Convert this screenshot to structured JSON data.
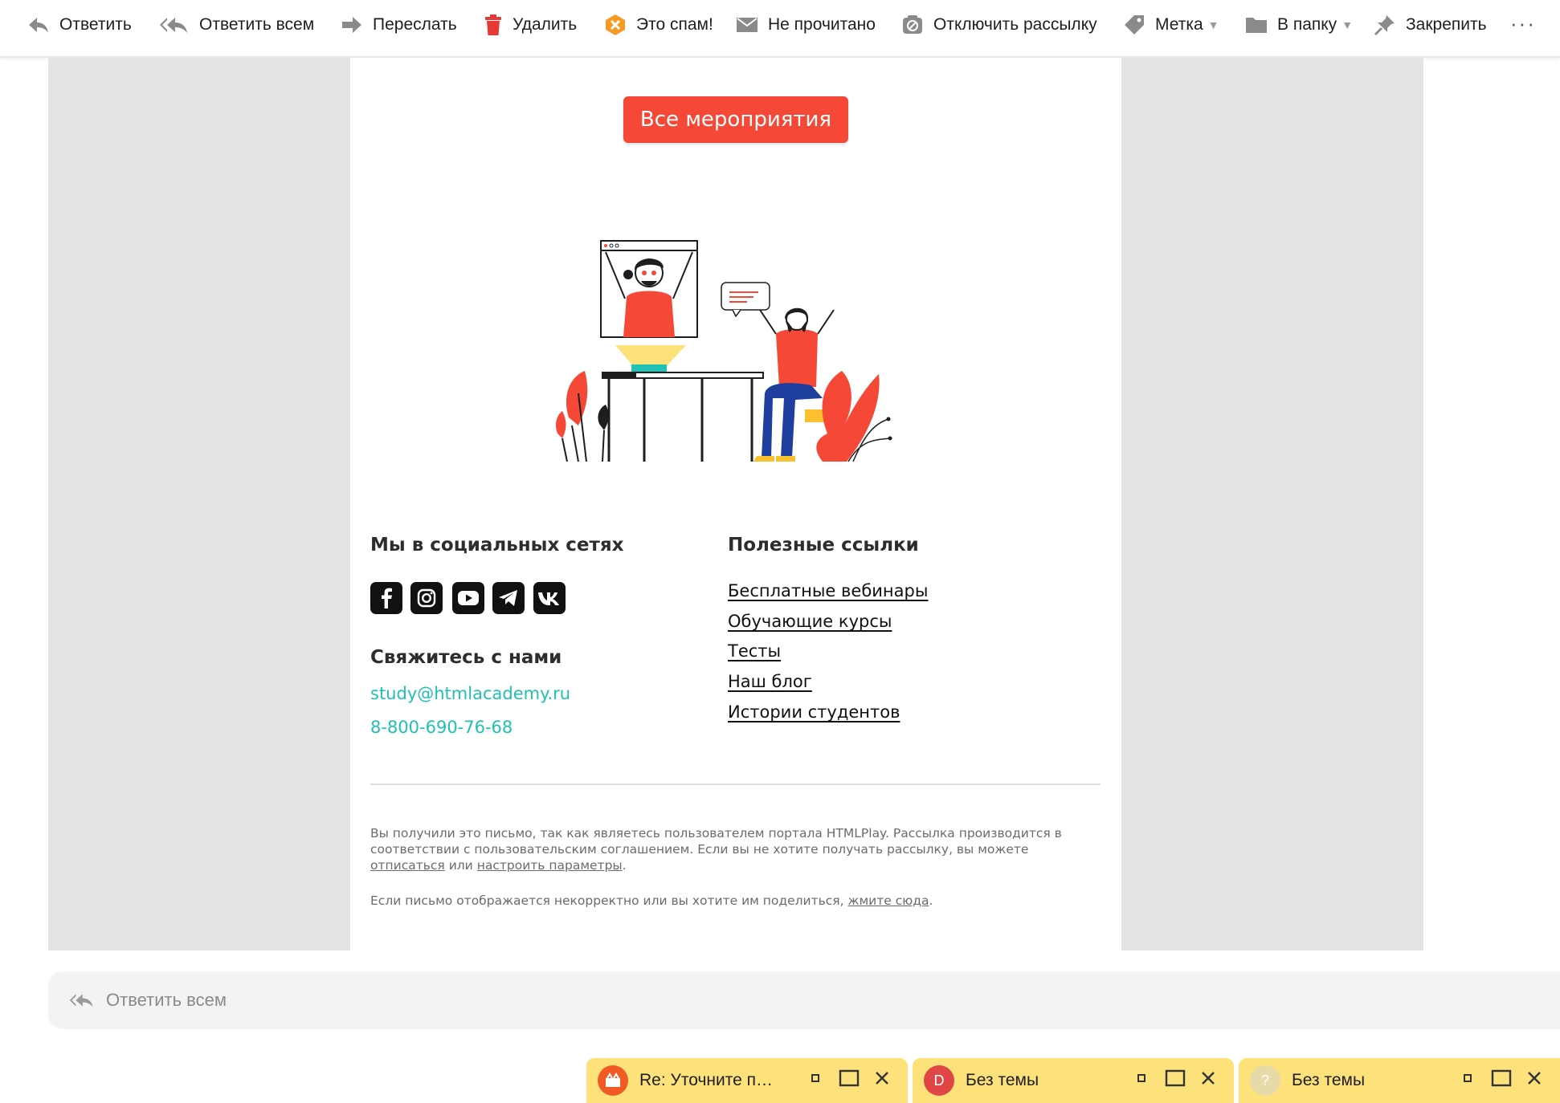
{
  "toolbar": {
    "reply": "Ответить",
    "reply_all": "Ответить всем",
    "forward": "Переслать",
    "delete": "Удалить",
    "spam": "Это спам!",
    "unread": "Не прочитано",
    "unsubscribe": "Отключить рассылку",
    "label": "Метка",
    "folder": "В папку",
    "pin": "Закрепить",
    "more": "···"
  },
  "email": {
    "cta": "Все мероприятия",
    "social_heading": "Мы в социальных сетях",
    "social_icons": [
      "facebook-icon",
      "instagram-icon",
      "youtube-icon",
      "telegram-icon",
      "vk-icon"
    ],
    "contact_heading": "Свяжитесь с нами",
    "email": "study@htmlacademy.ru",
    "phone": "8-800-690-76-68",
    "links_heading": "Полезные ссылки",
    "links": [
      "Бесплатные вебинары",
      "Обучающие курсы",
      "Тесты",
      "Наш блог",
      "Истории студентов"
    ],
    "footer_p1_a": "Вы получили это письмо, так как являетесь пользователем портала HTMLPlay. Рассылка производится в соответствии с пользовательским соглашением. Если вы не хотите получать рассылку, вы можете ",
    "footer_unsub": "отписаться",
    "footer_or": " или ",
    "footer_settings": "настроить параметры",
    "footer_dot": ".",
    "footer_p2_a": "Если письмо отображается некорректно или вы хотите им поделиться, ",
    "footer_here": "жмите сюда",
    "footer_p2_b": "."
  },
  "reply_bar": {
    "label": "Ответить всем"
  },
  "drafts": [
    {
      "title": "Re: Уточните п…",
      "avatar": ""
    },
    {
      "title": "Без темы",
      "avatar": "D"
    },
    {
      "title": "Без темы",
      "avatar": "?"
    }
  ],
  "colors": {
    "accent": "#f64836",
    "teal": "#20c0b4",
    "draft_bg": "#fde27c"
  }
}
